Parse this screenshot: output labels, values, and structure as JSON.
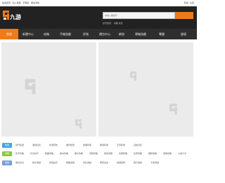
{
  "topbar": {
    "left_text": "設為首頁 · 加入收藏 · 手機版 · 網站導航 ·",
    "right_text": "登錄 | 注冊"
  },
  "logo": {
    "name": "九游"
  },
  "search": {
    "placeholder": "請輸入關鍵字"
  },
  "hot_searches": "熱門搜索：  攻略  禮包",
  "nav": {
    "items": [
      {
        "label": "首頁",
        "active": true
      },
      {
        "label": "新聞中心",
        "active": false
      },
      {
        "label": "攻略",
        "active": false
      },
      {
        "label": "手機游戲",
        "active": false
      },
      {
        "label": "評測",
        "active": false
      },
      {
        "label": "禮包中心",
        "active": false
      },
      {
        "label": "網游",
        "active": false
      },
      {
        "label": "單機游戲",
        "active": false
      },
      {
        "label": "專題",
        "active": false
      },
      {
        "label": "論壇",
        "active": false
      }
    ]
  },
  "categories": [
    {
      "tag": "新聞",
      "tag_color": "#3fa9e0",
      "links": [
        "熱門新聞",
        "游戲資訊",
        "新游預告",
        "業界動態",
        "產業新聞",
        "網游新聞",
        "手游新聞",
        "活動資訊"
      ]
    },
    {
      "tag": "攻略",
      "tag_color": "#8cc63f",
      "links": [
        "新手攻略",
        "玩法技巧",
        "職業攻略",
        "副本攻略",
        "圖文攻略",
        "視頻攻略",
        "角色攻略",
        "裝備攻略",
        "任務攻略",
        "寵物攻略",
        "通關攻略",
        "心得分享"
      ]
    },
    {
      "tag": "游戲",
      "tag_color": "#7a9fd6",
      "links": [
        "角色扮演",
        "動作游戲",
        "休閑益智",
        "策略游戲",
        "射擊游戲",
        "賽車競速",
        "模擬經營",
        "體育運動",
        "卡牌游戲"
      ]
    }
  ]
}
